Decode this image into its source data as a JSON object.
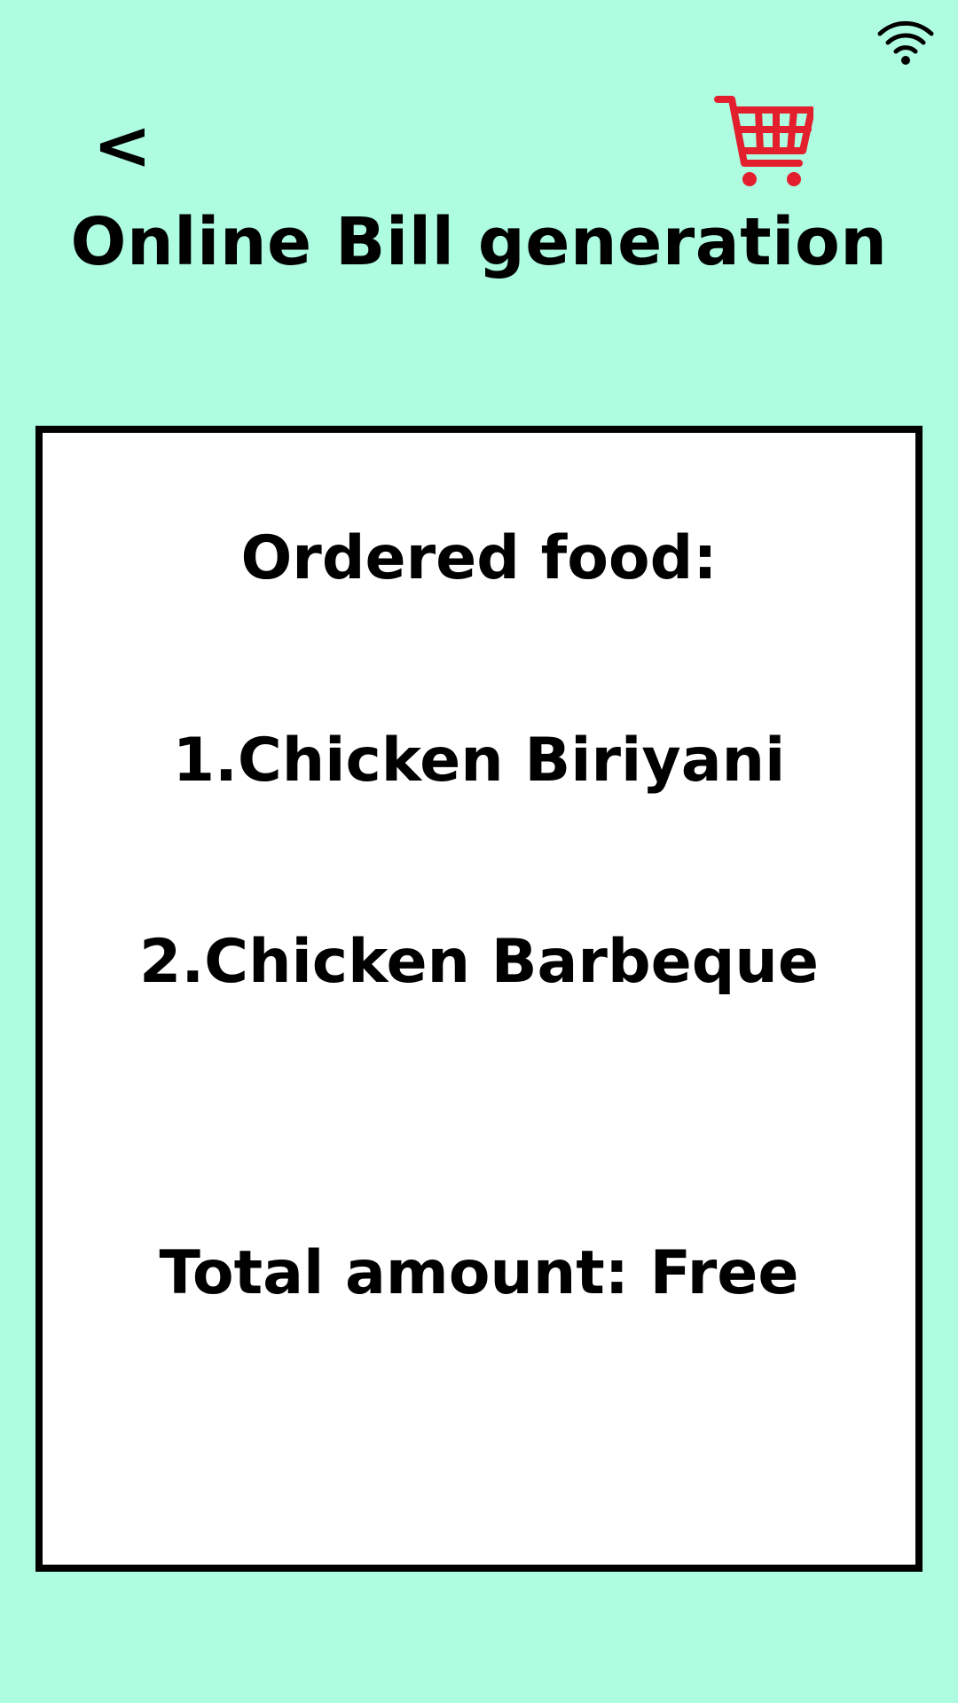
{
  "status_bar": {
    "wifi_icon": "wifi-icon"
  },
  "header": {
    "back_label": "<",
    "cart_icon": "shopping-cart-icon",
    "cart_color": "#e31e2d",
    "title": "Online Bill generation"
  },
  "bill": {
    "heading": "Ordered food:",
    "items": [
      {
        "label": "1.Chicken Biriyani"
      },
      {
        "label": "2.Chicken Barbeque"
      }
    ],
    "total": "Total amount: Free"
  },
  "colors": {
    "background": "#aefde0",
    "card": "#ffffff",
    "border": "#000000"
  }
}
